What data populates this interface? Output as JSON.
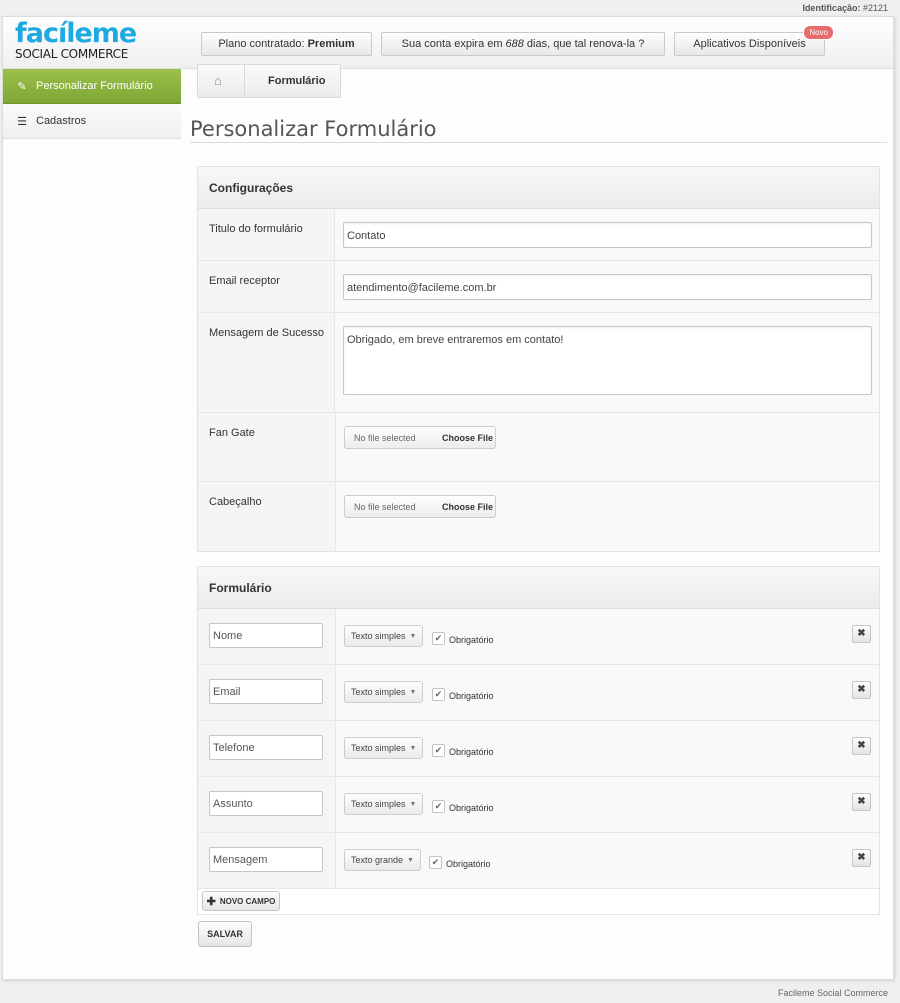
{
  "topbar": {
    "id_label": "Identificação:",
    "id_value": "#2121"
  },
  "logo": {
    "main": "facíleme",
    "sub": "SOCIAL COMMERCE"
  },
  "header": {
    "plan_label": "Plano contratado:",
    "plan_value": "Premium",
    "expire_prefix": "Sua conta expira em",
    "expire_days": "688",
    "expire_suffix": "dias, que tal renova-la ?",
    "apps_label": "Aplicativos Disponíveis",
    "apps_badge": "Novo"
  },
  "sidebar": {
    "items": [
      {
        "label": "Personalizar Formulário",
        "icon": "edit-icon"
      },
      {
        "label": "Cadastros",
        "icon": "list-icon"
      }
    ]
  },
  "breadcrumb": {
    "home_icon": "home-icon",
    "current": "Formulário"
  },
  "page": {
    "title": "Personalizar Formulário"
  },
  "config": {
    "heading": "Configurações",
    "title_label": "Titulo do formulário",
    "title_value": "Contato",
    "email_label": "Email receptor",
    "email_value": "atendimento@facileme.com.br",
    "success_label": "Mensagem de Sucesso",
    "success_value": "Obrigado, em breve entraremos em contato!",
    "fangate_label": "Fan Gate",
    "header_label": "Cabeçalho",
    "no_file": "No file selected",
    "choose_file": "Choose File"
  },
  "form": {
    "heading": "Formulário",
    "required_label": "Obrigatório",
    "fields": [
      {
        "name": "Nome",
        "type": "Texto simples",
        "required": true
      },
      {
        "name": "Email",
        "type": "Texto simples",
        "required": true
      },
      {
        "name": "Telefone",
        "type": "Texto simples",
        "required": true
      },
      {
        "name": "Assunto",
        "type": "Texto simples",
        "required": true
      },
      {
        "name": "Mensagem",
        "type": "Texto grande",
        "required": true
      }
    ],
    "add_label": "NOVO CAMPO"
  },
  "actions": {
    "save_label": "SALVAR"
  },
  "footer": {
    "text": "Facileme Social Commerce"
  },
  "colors": {
    "accent": "#1ea9e1",
    "active_nav": "#8db53f",
    "badge": "#e86a6a"
  }
}
